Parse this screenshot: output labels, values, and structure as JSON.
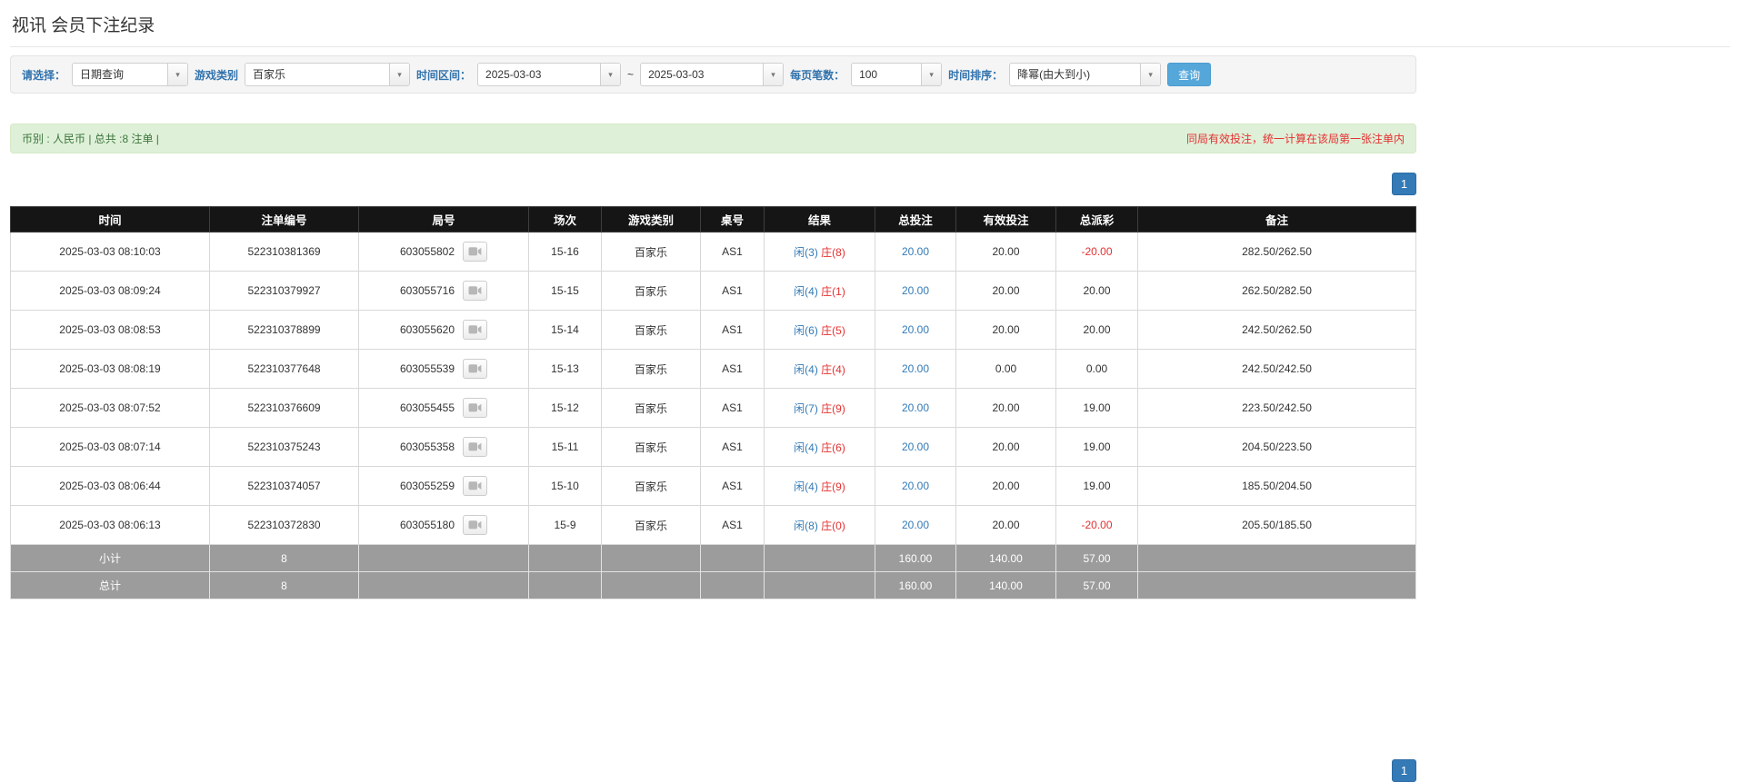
{
  "page": {
    "title": "视讯 会员下注纪录"
  },
  "filters": {
    "select_label": "请选择：",
    "select_value": "日期查询",
    "game_label": "游戏类别",
    "game_value": "百家乐",
    "range_label": "时间区间：",
    "date_from": "2025-03-03",
    "tilde": "~",
    "date_to": "2025-03-03",
    "page_size_label": "每页笔数：",
    "page_size_value": "100",
    "sort_label": "时间排序：",
    "sort_value": "降幂(由大到小)",
    "search_button": "查询"
  },
  "summary": {
    "left": "币别 : 人民币 | 总共 :8 注单 |",
    "right": "同局有效投注，统一计算在该局第一张注单内"
  },
  "pagination": {
    "page": "1"
  },
  "colors": {
    "accent_blue": "#337ab7",
    "negative_red": "#e53030",
    "header_black": "#151515",
    "footer_gray": "#9c9c9c",
    "alert_green_bg": "#dff0d8"
  },
  "icons": {
    "combo_arrow": "chevron-down-icon",
    "round_video": "video-replay-icon"
  },
  "table": {
    "headers": [
      "时间",
      "注单编号",
      "局号",
      "场次",
      "游戏类别",
      "桌号",
      "结果",
      "总投注",
      "有效投注",
      "总派彩",
      "备注"
    ],
    "rows": [
      {
        "time": "2025-03-03 08:10:03",
        "order_no": "522310381369",
        "round_no": "603055802",
        "session": "15-16",
        "game": "百家乐",
        "table_no": "AS1",
        "result_player": "闲(3)",
        "result_banker": "庄(8)",
        "total_bet": "20.00",
        "valid_bet": "20.00",
        "payout": "-20.00",
        "note": "282.50/262.50"
      },
      {
        "time": "2025-03-03 08:09:24",
        "order_no": "522310379927",
        "round_no": "603055716",
        "session": "15-15",
        "game": "百家乐",
        "table_no": "AS1",
        "result_player": "闲(4)",
        "result_banker": "庄(1)",
        "total_bet": "20.00",
        "valid_bet": "20.00",
        "payout": "20.00",
        "note": "262.50/282.50"
      },
      {
        "time": "2025-03-03 08:08:53",
        "order_no": "522310378899",
        "round_no": "603055620",
        "session": "15-14",
        "game": "百家乐",
        "table_no": "AS1",
        "result_player": "闲(6)",
        "result_banker": "庄(5)",
        "total_bet": "20.00",
        "valid_bet": "20.00",
        "payout": "20.00",
        "note": "242.50/262.50"
      },
      {
        "time": "2025-03-03 08:08:19",
        "order_no": "522310377648",
        "round_no": "603055539",
        "session": "15-13",
        "game": "百家乐",
        "table_no": "AS1",
        "result_player": "闲(4)",
        "result_banker": "庄(4)",
        "total_bet": "20.00",
        "valid_bet": "0.00",
        "payout": "0.00",
        "note": "242.50/242.50"
      },
      {
        "time": "2025-03-03 08:07:52",
        "order_no": "522310376609",
        "round_no": "603055455",
        "session": "15-12",
        "game": "百家乐",
        "table_no": "AS1",
        "result_player": "闲(7)",
        "result_banker": "庄(9)",
        "total_bet": "20.00",
        "valid_bet": "20.00",
        "payout": "19.00",
        "note": "223.50/242.50"
      },
      {
        "time": "2025-03-03 08:07:14",
        "order_no": "522310375243",
        "round_no": "603055358",
        "session": "15-11",
        "game": "百家乐",
        "table_no": "AS1",
        "result_player": "闲(4)",
        "result_banker": "庄(6)",
        "total_bet": "20.00",
        "valid_bet": "20.00",
        "payout": "19.00",
        "note": "204.50/223.50"
      },
      {
        "time": "2025-03-03 08:06:44",
        "order_no": "522310374057",
        "round_no": "603055259",
        "session": "15-10",
        "game": "百家乐",
        "table_no": "AS1",
        "result_player": "闲(4)",
        "result_banker": "庄(9)",
        "total_bet": "20.00",
        "valid_bet": "20.00",
        "payout": "19.00",
        "note": "185.50/204.50"
      },
      {
        "time": "2025-03-03 08:06:13",
        "order_no": "522310372830",
        "round_no": "603055180",
        "session": "15-9",
        "game": "百家乐",
        "table_no": "AS1",
        "result_player": "闲(8)",
        "result_banker": "庄(0)",
        "total_bet": "20.00",
        "valid_bet": "20.00",
        "payout": "-20.00",
        "note": "205.50/185.50"
      }
    ],
    "subtotal": {
      "label": "小计",
      "count": "8",
      "total_bet": "160.00",
      "valid_bet": "140.00",
      "payout": "57.00"
    },
    "total": {
      "label": "总计",
      "count": "8",
      "total_bet": "160.00",
      "valid_bet": "140.00",
      "payout": "57.00"
    }
  }
}
